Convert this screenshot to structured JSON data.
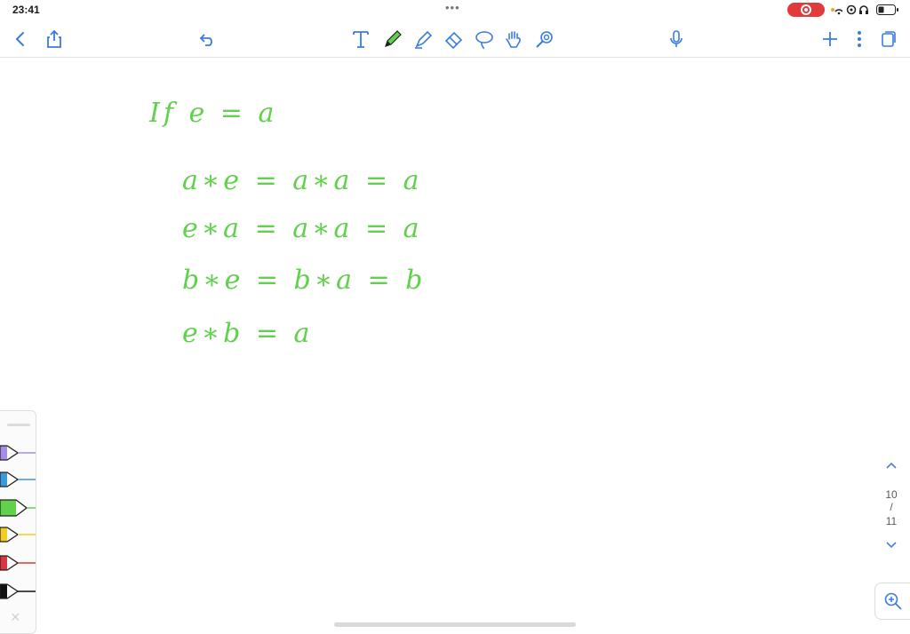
{
  "status": {
    "time": "23:41",
    "center_dots": "•••",
    "icons": [
      "recording-icon",
      "wifi-icon",
      "location-icon",
      "headphones-icon",
      "battery-icon"
    ]
  },
  "toolbar": {
    "left": [
      "back-icon",
      "share-icon",
      "undo-icon"
    ],
    "tools": [
      "text-tool-icon",
      "pen-tool-icon",
      "highlighter-tool-icon",
      "eraser-tool-icon",
      "lasso-tool-icon",
      "hand-tool-icon",
      "laser-pointer-icon"
    ],
    "center": [
      "microphone-icon"
    ],
    "right": [
      "add-page-icon",
      "more-options-icon",
      "pages-icon"
    ]
  },
  "notes": {
    "ink_color": "#5fd14a",
    "lines": [
      "If   e = a",
      "a∗e = a∗a = a",
      "e∗a = a∗a = a",
      "b∗e = b∗a = b",
      "e∗b = a"
    ]
  },
  "pen_tray": {
    "pens": [
      {
        "color": "#a78be8"
      },
      {
        "color": "#3a9ad9"
      },
      {
        "color": "#5fd14a"
      },
      {
        "color": "#f2cc1f"
      },
      {
        "color": "#d9363e"
      },
      {
        "color": "#111111"
      }
    ],
    "close": "×"
  },
  "page_nav": {
    "current": "10",
    "slash": "/",
    "total": "11",
    "up": "⌃",
    "down": "⌄"
  }
}
